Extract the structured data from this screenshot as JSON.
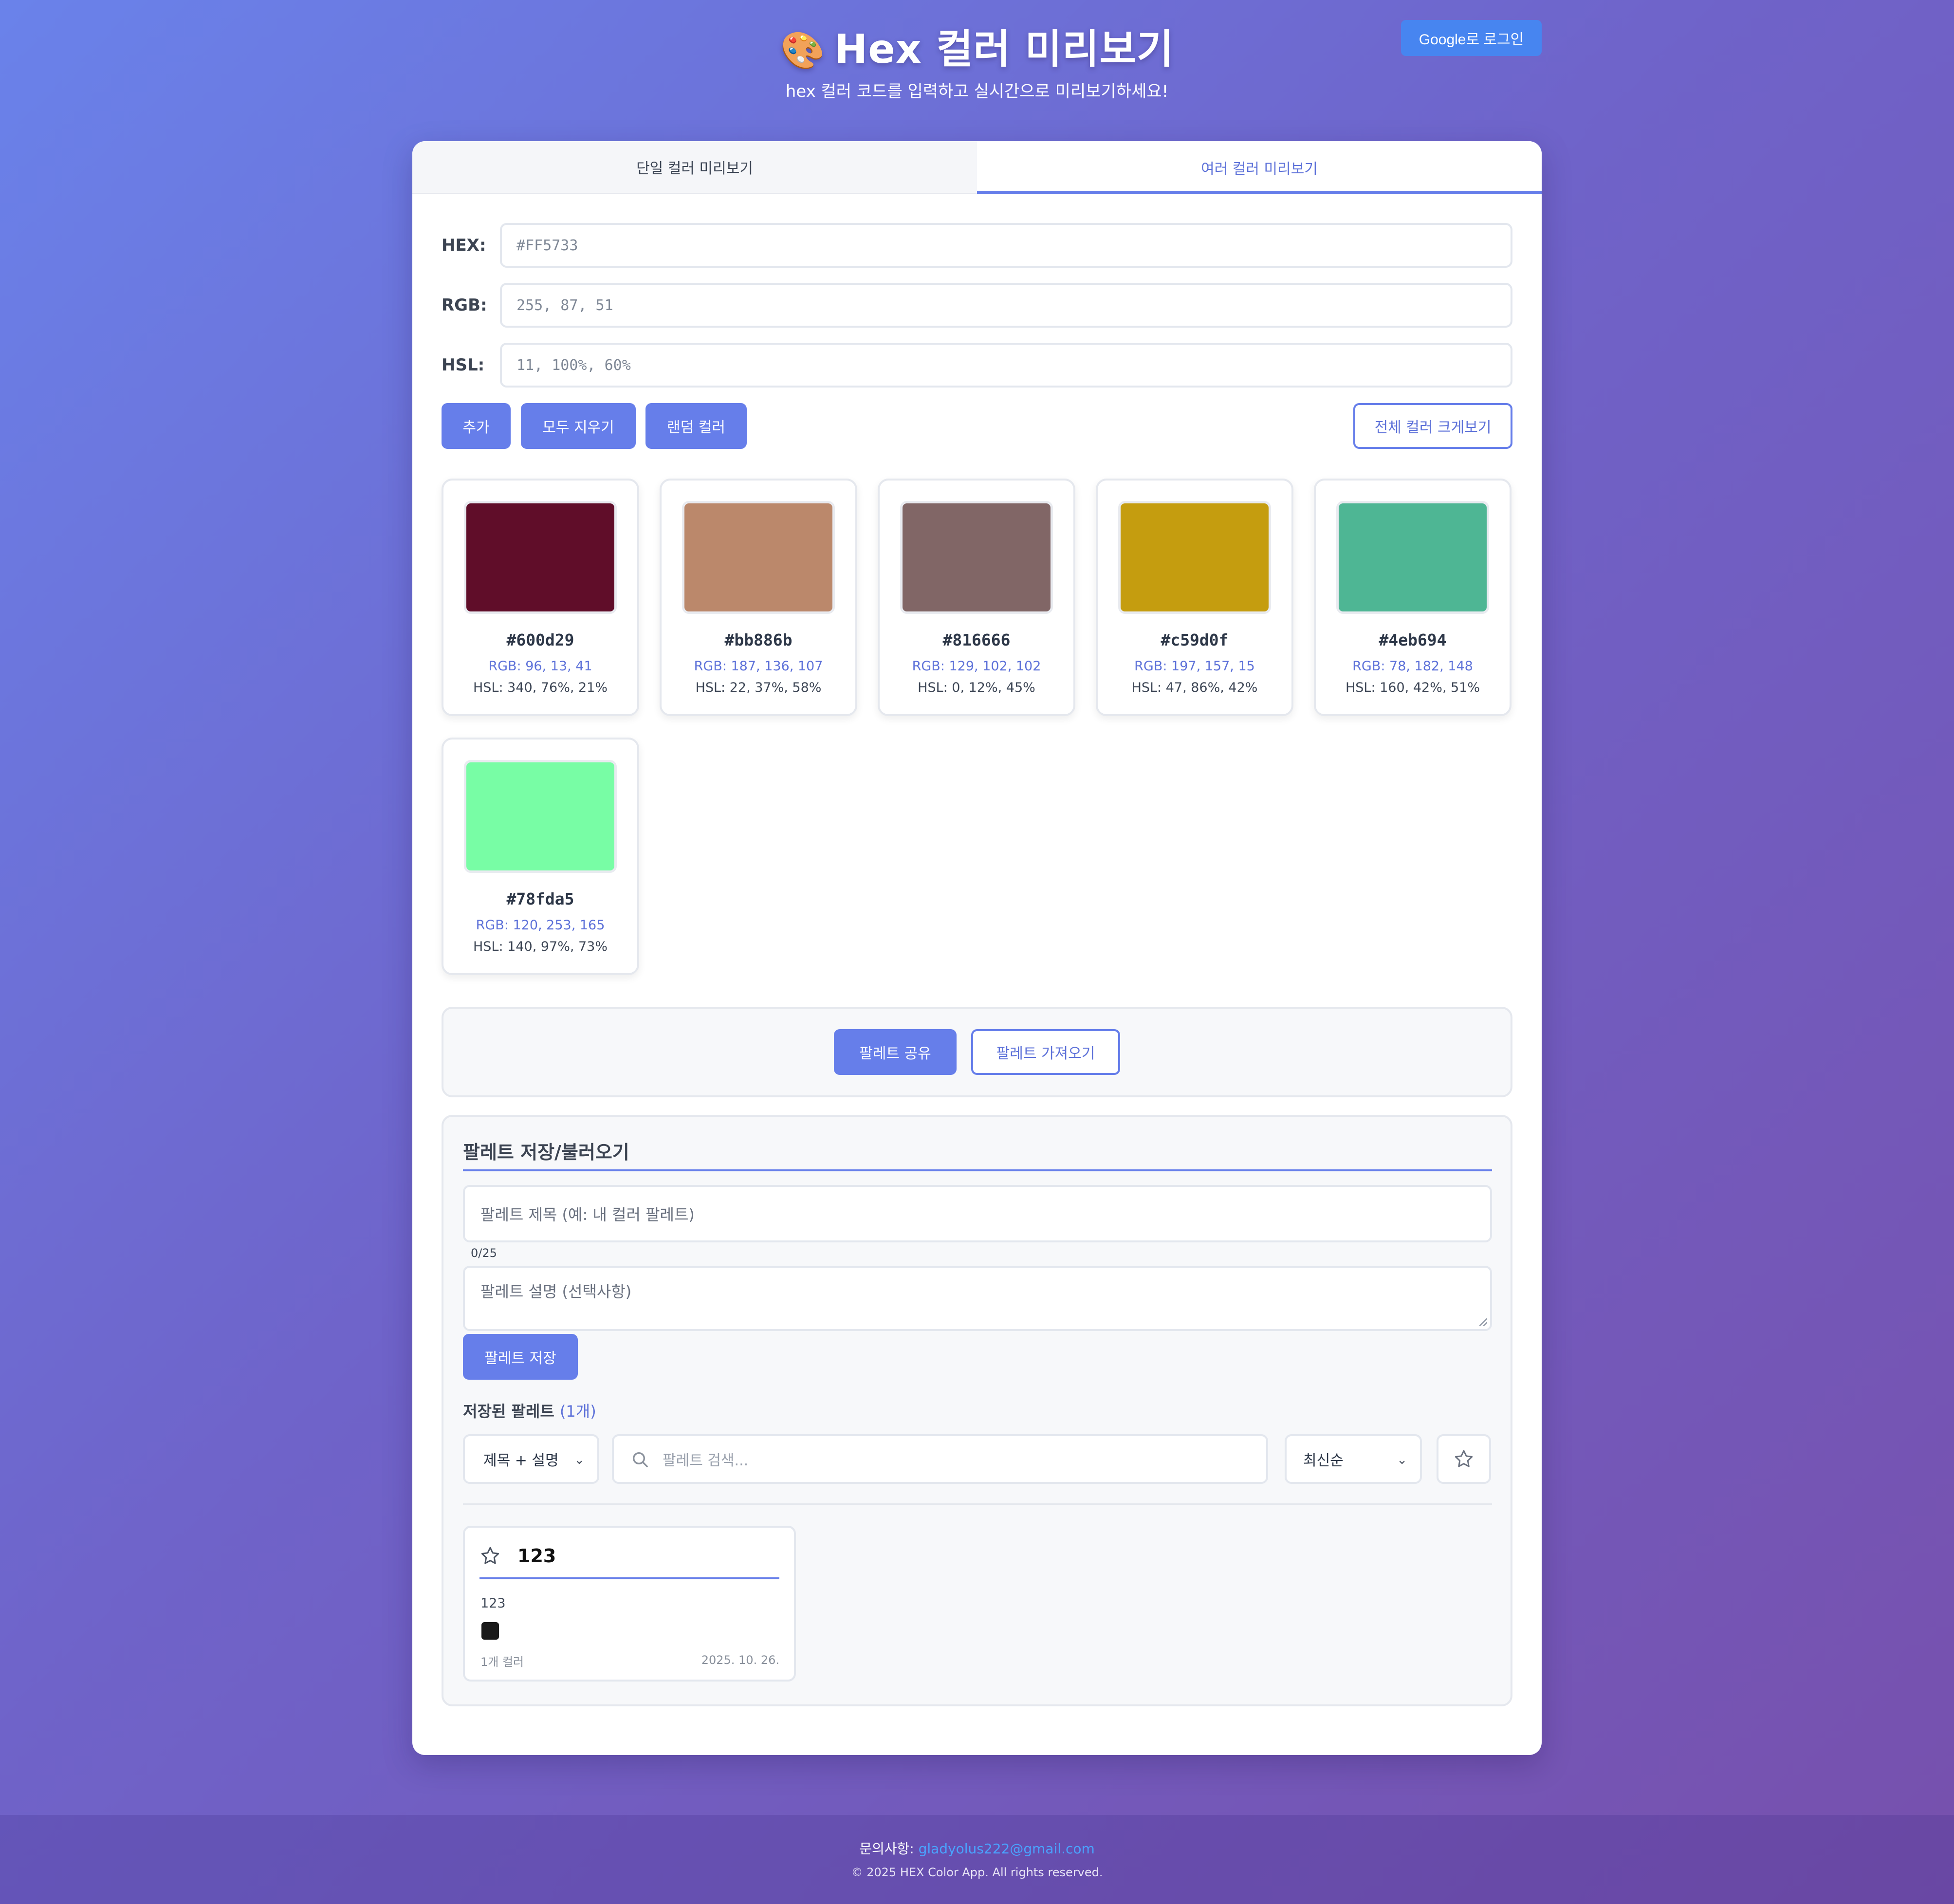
{
  "header": {
    "emoji": "🎨",
    "title": "Hex 컬러 미리보기",
    "subtitle": "hex 컬러 코드를 입력하고 실시간으로 미리보기하세요!",
    "login_label": "Google로 로그인"
  },
  "tabs": [
    {
      "label": "단일 컬러 미리보기",
      "active": false
    },
    {
      "label": "여러 컬러 미리보기",
      "active": true
    }
  ],
  "fields": {
    "hex": {
      "label": "HEX:",
      "placeholder": "#FF5733"
    },
    "rgb": {
      "label": "RGB:",
      "placeholder": "255, 87, 51"
    },
    "hsl": {
      "label": "HSL:",
      "placeholder": "11, 100%, 60%"
    }
  },
  "actions": {
    "add": "추가",
    "clear_all": "모두 지우기",
    "random": "랜덤 컬러",
    "view_all": "전체 컬러 크게보기"
  },
  "colors": [
    {
      "hex": "#600d29",
      "rgb": "RGB: 96, 13, 41",
      "hsl": "HSL: 340, 76%, 21%"
    },
    {
      "hex": "#bb886b",
      "rgb": "RGB: 187, 136, 107",
      "hsl": "HSL: 22, 37%, 58%"
    },
    {
      "hex": "#816666",
      "rgb": "RGB: 129, 102, 102",
      "hsl": "HSL: 0, 12%, 45%"
    },
    {
      "hex": "#c59d0f",
      "rgb": "RGB: 197, 157, 15",
      "hsl": "HSL: 47, 86%, 42%"
    },
    {
      "hex": "#4eb694",
      "rgb": "RGB: 78, 182, 148",
      "hsl": "HSL: 160, 42%, 51%"
    },
    {
      "hex": "#78fda5",
      "rgb": "RGB: 120, 253, 165",
      "hsl": "HSL: 140, 97%, 73%"
    }
  ],
  "share": {
    "share_label": "팔레트 공유",
    "import_label": "팔레트 가져오기"
  },
  "save": {
    "title": "팔레트 저장/불러오기",
    "title_placeholder": "팔레트 제목 (예: 내 컬러 팔레트)",
    "counter": "0/25",
    "desc_placeholder": "팔레트 설명 (선택사항)",
    "save_label": "팔레트 저장",
    "saved_heading": "저장된 팔레트",
    "saved_count": "(1개)",
    "scope_select": "제목 + 설명",
    "search_placeholder": "팔레트 검색...",
    "sort_select": "최신순"
  },
  "saved_palettes": [
    {
      "name": "123",
      "description": "123",
      "chip_color": "#1a1a1a",
      "count": "1개 컬러",
      "date": "2025. 10. 26."
    }
  ],
  "footer": {
    "contact_label": "문의사항:",
    "email": "gladyolus222@gmail.com",
    "copyright": "© 2025 HEX Color App. All rights reserved."
  },
  "theme": {
    "accent": "#667eea",
    "login_blue": "#4785f0",
    "link_blue": "#4aa3ff"
  }
}
